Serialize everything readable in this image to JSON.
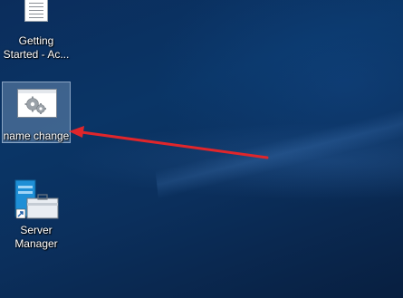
{
  "desktop": {
    "icons": [
      {
        "label_line1": "Getting",
        "label_line2": "Started - Ac...",
        "icon": "document-icon"
      },
      {
        "label": "name change",
        "icon": "gears-window-icon",
        "selected": true
      },
      {
        "label_line1": "Server",
        "label_line2": "Manager",
        "icon": "server-manager-icon"
      }
    ],
    "annotation": {
      "color": "#e0262b",
      "type": "arrow-pointing-to-name-change"
    }
  }
}
